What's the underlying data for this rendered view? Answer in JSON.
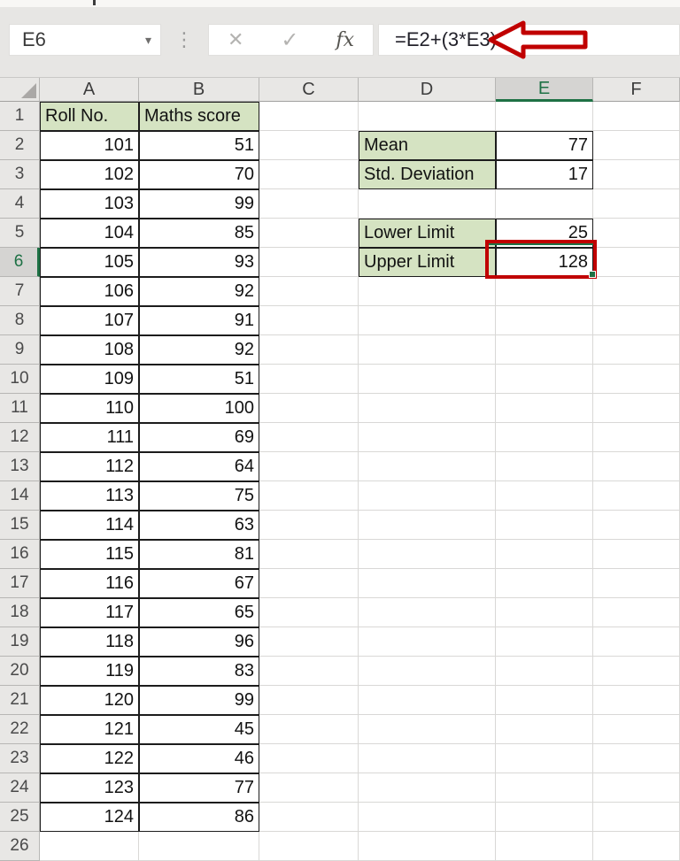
{
  "formula_bar": {
    "name_box_value": "E6",
    "formula": "=E2+(3*E3)",
    "cancel_icon": "✕",
    "enter_icon": "✓",
    "fx_label": "fx",
    "dropdown_icon": "▾",
    "separator_icon": "⋮"
  },
  "grid": {
    "column_headers": [
      "A",
      "B",
      "C",
      "D",
      "E",
      "F"
    ],
    "selected_column": "E",
    "selected_row": 6,
    "row_count": 26
  },
  "score_table": {
    "headers": [
      "Roll No.",
      "Maths score"
    ],
    "rows": [
      [
        101,
        51
      ],
      [
        102,
        70
      ],
      [
        103,
        99
      ],
      [
        104,
        85
      ],
      [
        105,
        93
      ],
      [
        106,
        92
      ],
      [
        107,
        91
      ],
      [
        108,
        92
      ],
      [
        109,
        51
      ],
      [
        110,
        100
      ],
      [
        111,
        69
      ],
      [
        112,
        64
      ],
      [
        113,
        75
      ],
      [
        114,
        63
      ],
      [
        115,
        81
      ],
      [
        116,
        67
      ],
      [
        117,
        65
      ],
      [
        118,
        96
      ],
      [
        119,
        83
      ],
      [
        120,
        99
      ],
      [
        121,
        45
      ],
      [
        122,
        46
      ],
      [
        123,
        77
      ],
      [
        124,
        86
      ]
    ]
  },
  "stats": [
    {
      "label": "Mean",
      "value": "77",
      "row": 2
    },
    {
      "label": "Std. Deviation",
      "value": "17",
      "row": 3
    },
    {
      "label": "Lower Limit",
      "value": "25",
      "row": 5
    },
    {
      "label": "Upper Limit",
      "value": "128",
      "row": 6
    }
  ],
  "colors": {
    "cell_fill_green": "#d5e3c2",
    "accent_green": "#1e7145",
    "annotation_red": "#c00000"
  }
}
